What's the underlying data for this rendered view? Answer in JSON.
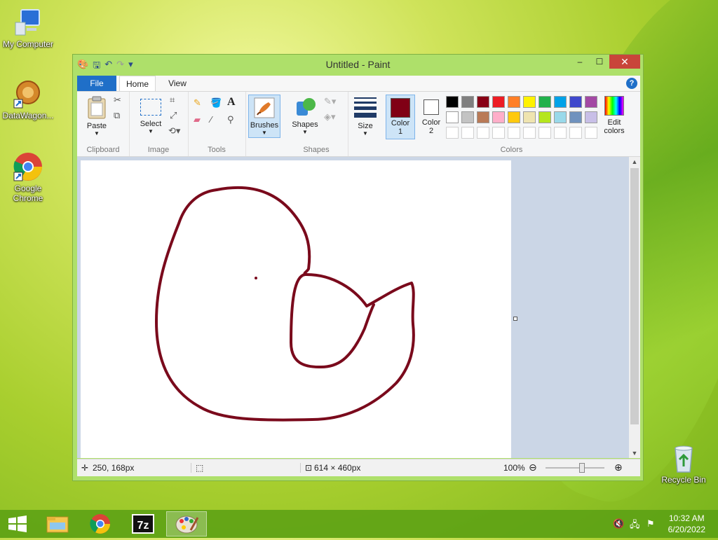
{
  "desktop": {
    "icons": [
      {
        "label": "My Computer"
      },
      {
        "label": "DataWagon..."
      },
      {
        "label": "Google Chrome"
      },
      {
        "label": "Recycle Bin"
      }
    ]
  },
  "window": {
    "title": "Untitled - Paint",
    "controls": {
      "minimize": "–",
      "maximize": "☐",
      "close": "✕"
    }
  },
  "menu": {
    "file": "File",
    "home": "Home",
    "view": "View",
    "help": "?"
  },
  "ribbon": {
    "clipboard": {
      "label": "Clipboard",
      "paste": "Paste"
    },
    "image": {
      "label": "Image",
      "select": "Select"
    },
    "tools": {
      "label": "Tools",
      "text_tool": "A"
    },
    "brushes": {
      "label": "Brushes"
    },
    "shapes": {
      "label": "Shapes",
      "shapes_btn": "Shapes"
    },
    "size": {
      "label": "Size"
    },
    "colors": {
      "label": "Colors",
      "color1": "Color\n1",
      "color2": "Color\n2",
      "edit": "Edit colors",
      "color1_value": "#800015",
      "color2_value": "#ffffff",
      "palette_row1": [
        "#000000",
        "#7f7f7f",
        "#880015",
        "#ed1c24",
        "#ff7f27",
        "#fff200",
        "#22b14c",
        "#00a2e8",
        "#3f48cc",
        "#a349a4"
      ],
      "palette_row2": [
        "#ffffff",
        "#c3c3c3",
        "#b97a57",
        "#ffaec9",
        "#ffc90e",
        "#efe4b0",
        "#b5e61d",
        "#99d9ea",
        "#7092be",
        "#c8bfe7"
      ],
      "palette_row3": [
        "#ffffff",
        "#ffffff",
        "#ffffff",
        "#ffffff",
        "#ffffff",
        "#ffffff",
        "#ffffff",
        "#ffffff",
        "#ffffff",
        "#ffffff"
      ]
    }
  },
  "status": {
    "cursor_pos": "250, 168px",
    "image_size": "614 × 460px",
    "zoom": "100%",
    "zoom_level": 1.0
  },
  "stroke_color": "#7a0a1c",
  "taskbar": {
    "clock_time": "10:32 AM",
    "clock_date": "6/20/2022"
  }
}
